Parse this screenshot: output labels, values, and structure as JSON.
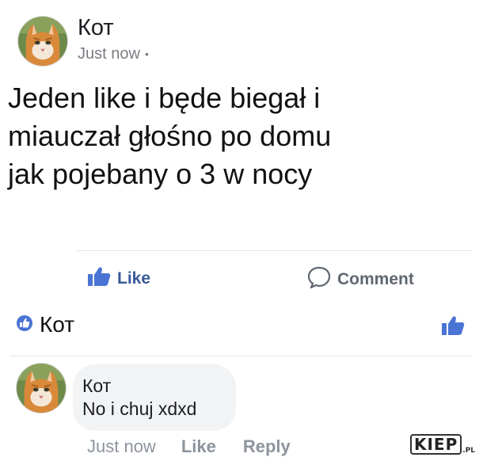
{
  "post": {
    "author": "Кот",
    "time": "Just now",
    "privacy_dot": "•",
    "text": "Jeden like i będe biegał i\nmiauczał głośno po domu\njak pojebany o 3 w nocy"
  },
  "actions": {
    "like_label": "Like",
    "comment_label": "Comment"
  },
  "reaction": {
    "reactor_name": "Кот"
  },
  "comment": {
    "author": "Кот",
    "text": "No i chuj xdxd",
    "time": "Just now",
    "like_label": "Like",
    "reply_label": "Reply"
  },
  "watermark": {
    "text": "KIEP",
    "suffix": ".PL"
  },
  "colors": {
    "brand_blue": "#385898",
    "like_blue": "#4a74d4",
    "muted_text": "#8d949e",
    "bubble_bg": "#f2f3f5"
  },
  "icons": {
    "like_action": "thumbs-up-icon",
    "comment_action": "speech-bubble-icon",
    "reaction": "like-badge-icon"
  }
}
